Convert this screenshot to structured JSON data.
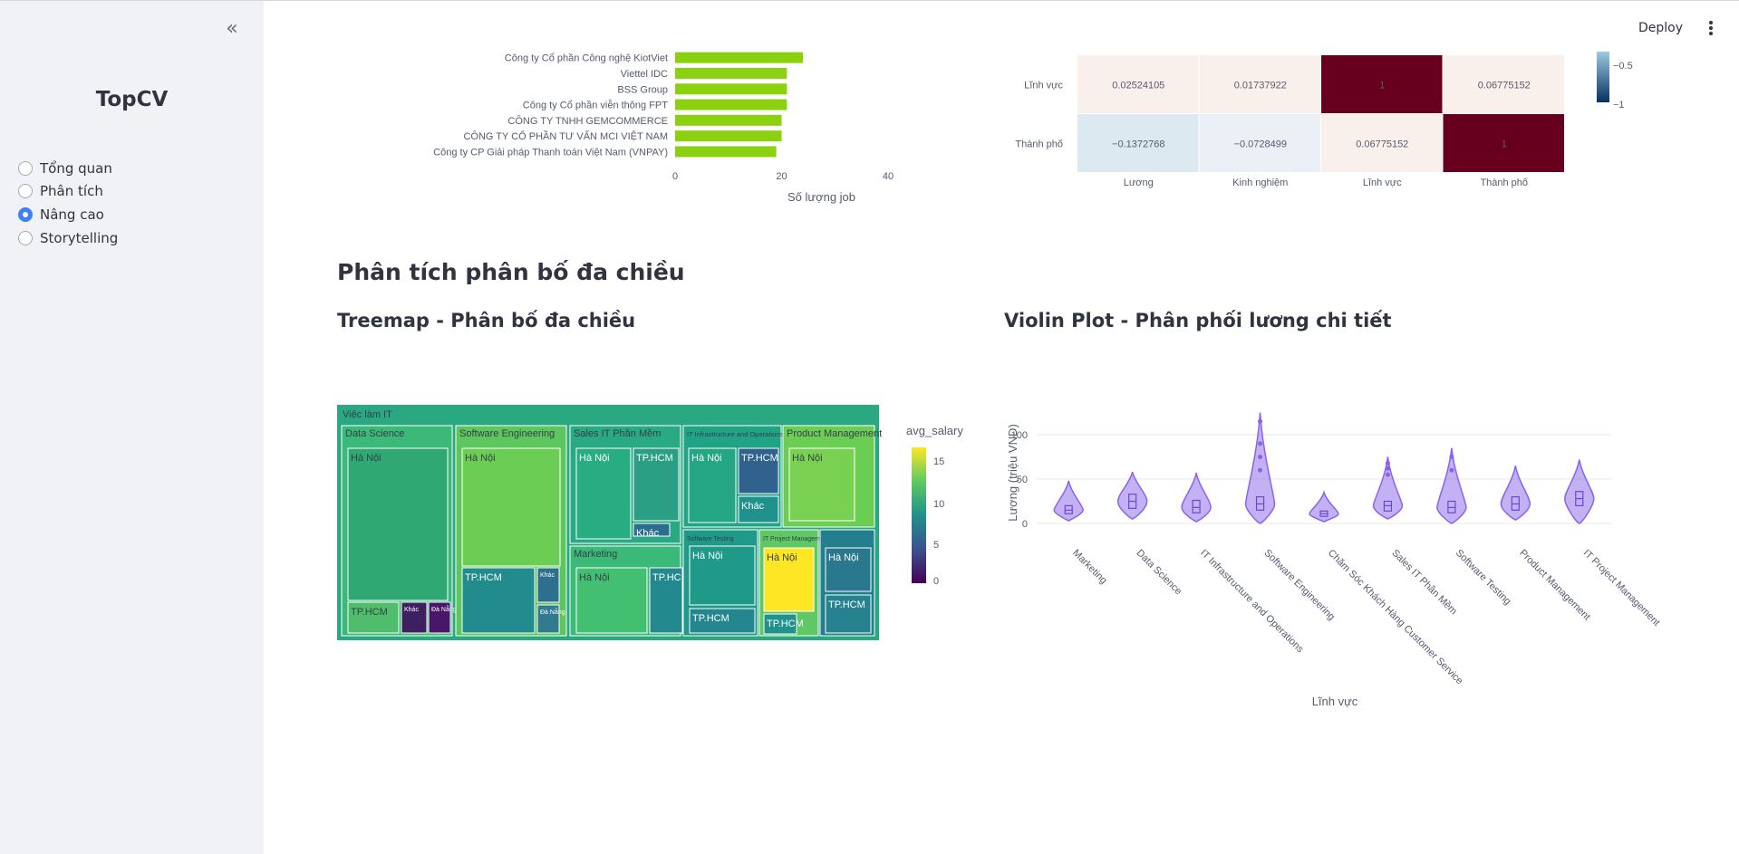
{
  "sidebar": {
    "brand": "TopCV",
    "collapse_glyph": "«",
    "nav": [
      {
        "label": "Tổng quan",
        "checked": false
      },
      {
        "label": "Phân tích",
        "checked": false
      },
      {
        "label": "Nâng cao",
        "checked": true
      },
      {
        "label": "Storytelling",
        "checked": false
      }
    ]
  },
  "header": {
    "deploy_label": "Deploy"
  },
  "sections": {
    "multi_title": "Phân tích phân bố đa chiều",
    "treemap_title": "Treemap - Phân bố đa chiều",
    "violin_title": "Violin Plot - Phân phối lương chi tiết"
  },
  "chart_data": [
    {
      "type": "bar",
      "orientation": "horizontal",
      "categories": [
        "Công ty Cổ phần Công nghệ KiotViet",
        "Viettel IDC",
        "BSS Group",
        "Công ty Cổ phần viễn thông FPT",
        "CÔNG TY TNHH GEMCOMMERCE",
        "CÔNG TY CỔ PHẦN TƯ VẤN MCI VIỆT NAM",
        "Công ty CP Giải pháp Thanh toán Việt Nam (VNPAY)"
      ],
      "values": [
        24,
        21,
        21,
        21,
        20,
        20,
        19
      ],
      "xlabel": "Số lượng job",
      "xticks": [
        0,
        20,
        40
      ],
      "xlim": [
        0,
        40
      ],
      "color": "#8bd10f"
    },
    {
      "type": "heatmap",
      "rows": [
        "Lĩnh vực",
        "Thành phố"
      ],
      "cols": [
        "Lương",
        "Kinh nghiệm",
        "Lĩnh vực",
        "Thành phố"
      ],
      "values": [
        [
          0.02524105,
          0.01737922,
          1,
          0.06775152
        ],
        [
          -0.1372768,
          -0.0728499,
          0.06775152,
          1
        ]
      ],
      "labels": [
        [
          "0.02524105",
          "0.01737922",
          "1",
          "0.06775152"
        ],
        [
          "−0.1372768",
          "−0.0728499",
          "0.06775152",
          "1"
        ]
      ],
      "colorbar_ticks": [
        "−0.5",
        "−1"
      ]
    },
    {
      "type": "treemap",
      "root": "Việc làm IT",
      "colorbar_title": "avg_salary",
      "colorbar_ticks": [
        15,
        10,
        5,
        0
      ],
      "groups": [
        {
          "name": "Data Science",
          "children": [
            {
              "name": "Hà Nội",
              "color": "#2fa874"
            },
            {
              "name": "TP.HCM",
              "color": "#4fbd6b"
            },
            {
              "name": "Khác",
              "color": "#3e1f5f"
            },
            {
              "name": "Đà Nẵng",
              "color": "#48176a"
            }
          ]
        },
        {
          "name": "Software Engineering",
          "children": [
            {
              "name": "Hà Nội",
              "color": "#6ccd55"
            },
            {
              "name": "TP.HCM",
              "color": "#228b8d"
            },
            {
              "name": "Khác",
              "color": "#2f6f8e"
            },
            {
              "name": "Đà Nẵng",
              "color": "#327a8e"
            }
          ]
        },
        {
          "name": "Sales IT Phần Mềm",
          "children": [
            {
              "name": "Hà Nội",
              "color": "#27ad81"
            },
            {
              "name": "TP.HCM",
              "color": "#2a9f84"
            },
            {
              "name": "Khác",
              "color": "#2a6d8e"
            }
          ]
        },
        {
          "name": "Marketing",
          "children": [
            {
              "name": "Hà Nội",
              "color": "#43bf71"
            },
            {
              "name": "TP.HCM",
              "color": "#23898e"
            }
          ]
        },
        {
          "name": "IT Infrastructure and Operations",
          "children": [
            {
              "name": "Hà Nội",
              "color": "#24a584"
            },
            {
              "name": "TP.HCM",
              "color": "#31618d"
            },
            {
              "name": "Khác",
              "color": "#20928c"
            }
          ]
        },
        {
          "name": "Software Testing",
          "children": [
            {
              "name": "Hà Nội",
              "color": "#1f9a8a"
            },
            {
              "name": "TP.HCM",
              "color": "#24868e"
            }
          ]
        },
        {
          "name": "Product Management",
          "children": [
            {
              "name": "Hà Nội",
              "color": "#7ad151"
            }
          ]
        },
        {
          "name": "IT Project Management",
          "children": [
            {
              "name": "Hà Nội",
              "color": "#fde725"
            },
            {
              "name": "TP.HCM",
              "color": "#21918c"
            }
          ]
        },
        {
          "name": "",
          "children": [
            {
              "name": "Hà Nội",
              "color": "#2a788e"
            },
            {
              "name": "TP.HCM",
              "color": "#26828e"
            }
          ]
        }
      ]
    },
    {
      "type": "violin",
      "categories": [
        "Marketing",
        "Data Science",
        "IT Infrastructure and Operations",
        "Software Engineering",
        "Chăm Sóc Khách Hàng Customer Service",
        "Sales IT Phần Mềm",
        "Software Testing",
        "Product Management",
        "IT Project Management"
      ],
      "median": [
        15,
        25,
        18,
        22,
        11,
        20,
        18,
        22,
        28
      ],
      "q1": [
        11,
        17,
        12,
        15,
        8,
        14,
        12,
        15,
        20
      ],
      "q3": [
        20,
        33,
        26,
        30,
        14,
        25,
        25,
        30,
        36
      ],
      "min": [
        3,
        5,
        2,
        0,
        2,
        5,
        0,
        4,
        0
      ],
      "max": [
        48,
        58,
        57,
        125,
        35,
        75,
        85,
        65,
        72
      ],
      "outliers": [
        [],
        [],
        [],
        [
          60,
          75,
          90,
          115
        ],
        [],
        [
          55,
          62,
          68
        ],
        [
          60,
          75
        ],
        [],
        []
      ],
      "ylabel": "Lương (triệu VND)",
      "xlabel": "Lĩnh vực",
      "yticks": [
        0,
        50,
        100
      ],
      "color": "#8a63ea"
    }
  ]
}
